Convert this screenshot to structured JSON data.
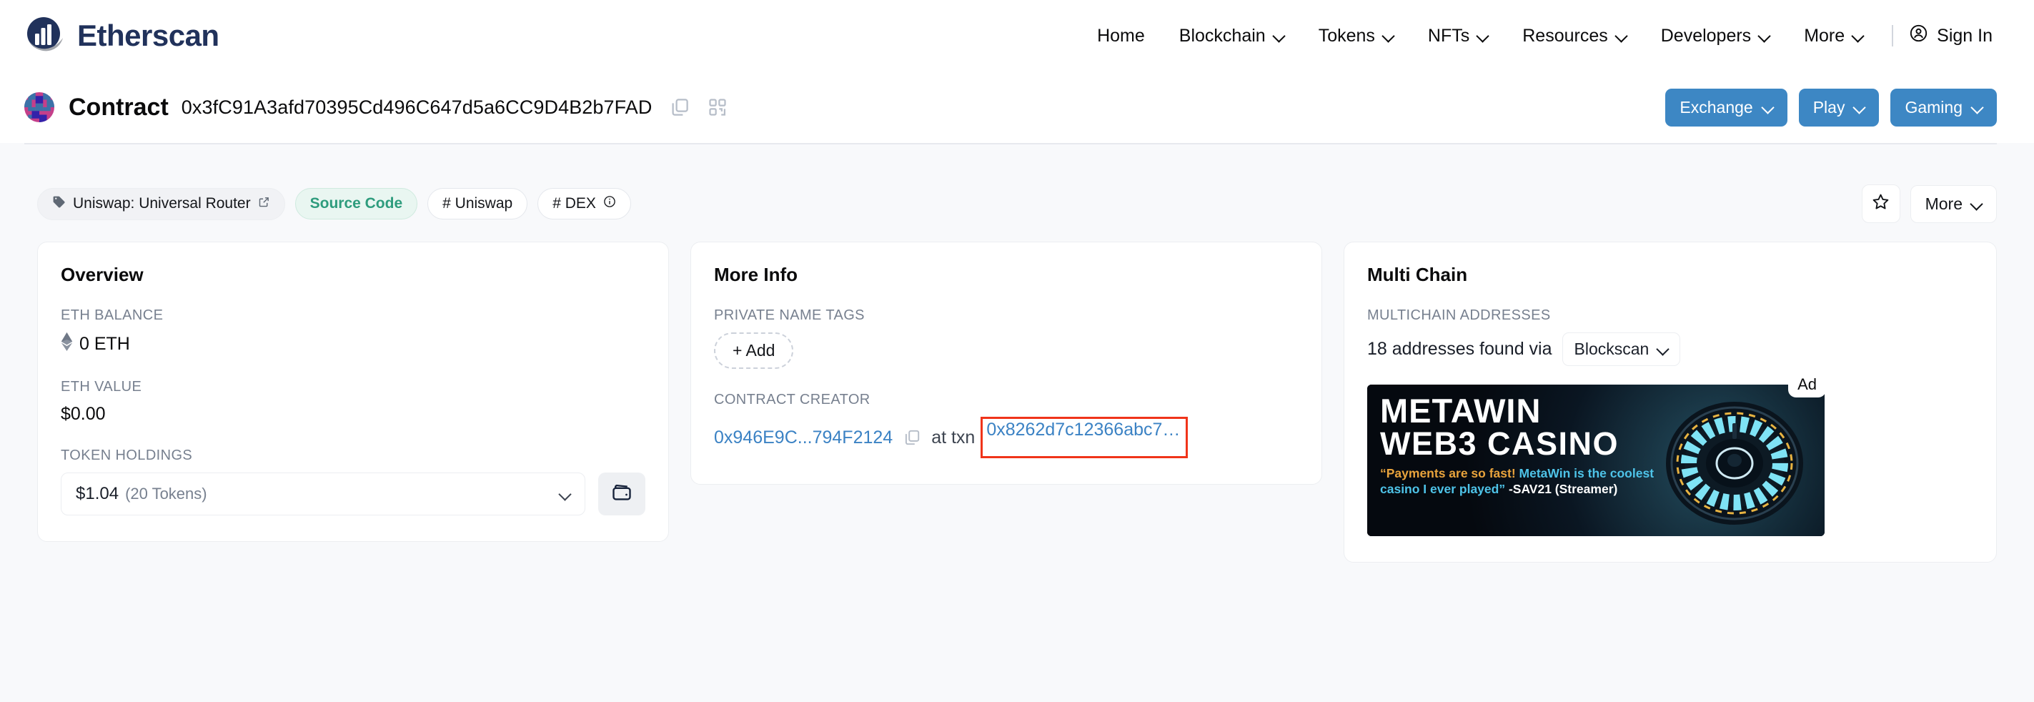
{
  "brand": {
    "name": "Etherscan",
    "logo_icon": "etherscan-logo"
  },
  "nav": {
    "items": [
      {
        "label": "Home",
        "has_chevron": false
      },
      {
        "label": "Blockchain",
        "has_chevron": true
      },
      {
        "label": "Tokens",
        "has_chevron": true
      },
      {
        "label": "NFTs",
        "has_chevron": true
      },
      {
        "label": "Resources",
        "has_chevron": true
      },
      {
        "label": "Developers",
        "has_chevron": true
      },
      {
        "label": "More",
        "has_chevron": true
      }
    ],
    "signin_label": "Sign In",
    "signin_icon": "user-circle-icon"
  },
  "contract_header": {
    "avatar_icon": "address-blockie-avatar",
    "title": "Contract",
    "address": "0x3fC91A3afd70395Cd496C647d5a6CC9D4B2b7FAD",
    "copy_icon": "copy-icon",
    "qr_icon": "qr-code-icon",
    "actions": [
      {
        "label": "Exchange",
        "color": "#3d87c4"
      },
      {
        "label": "Play",
        "color": "#3d87c4"
      },
      {
        "label": "Gaming",
        "color": "#3d87c4"
      }
    ]
  },
  "tags": {
    "items": [
      {
        "label": "Uniswap: Universal Router",
        "style": "gray",
        "lead_icon": "tag-icon",
        "trail_icon": "external-link-icon"
      },
      {
        "label": "Source Code",
        "style": "green",
        "lead_icon": "",
        "trail_icon": ""
      },
      {
        "label": "# Uniswap",
        "style": "white",
        "lead_icon": "",
        "trail_icon": ""
      },
      {
        "label": "# DEX",
        "style": "white",
        "lead_icon": "",
        "trail_icon": "info-icon"
      }
    ],
    "favorite_icon": "star-icon",
    "more_label": "More"
  },
  "overview": {
    "title": "Overview",
    "eth_balance_label": "ETH BALANCE",
    "eth_balance_value": "0 ETH",
    "eth_icon": "ethereum-diamond-icon",
    "eth_value_label": "ETH VALUE",
    "eth_value_value": "$0.00",
    "token_holdings_label": "TOKEN HOLDINGS",
    "token_holdings_amount": "$1.04",
    "token_holdings_count": "(20 Tokens)",
    "wallet_icon": "wallet-icon"
  },
  "more_info": {
    "title": "More Info",
    "private_name_tags_label": "PRIVATE NAME TAGS",
    "add_label": "+ Add",
    "contract_creator_label": "CONTRACT CREATOR",
    "creator_address": "0x946E9C...794F2124",
    "creator_copy_icon": "copy-icon",
    "at_txn_text": "at txn",
    "txn_hash": "0x8262d7c12366abc7…",
    "highlight_color": "#f0341a"
  },
  "multi_chain": {
    "title": "Multi Chain",
    "addresses_label": "MULTICHAIN ADDRESSES",
    "addresses_text": "18 addresses found via",
    "provider": "Blockscan"
  },
  "ad": {
    "badge": "Ad",
    "title": "METAWIN",
    "subtitle": "WEB3 CASINO",
    "quote_part1": "“Payments are so fast!",
    "quote_part2": " MetaWin is the coolest casino I ever played”",
    "quote_part3": " -SAV21 (Streamer)"
  },
  "colors": {
    "page_bg": "#f8f9fb",
    "brand_navy": "#21325b",
    "link_blue": "#3b82c4",
    "accent_blue": "#3d87c4",
    "green": "#2e9c7d",
    "highlight_red": "#f0341a"
  }
}
